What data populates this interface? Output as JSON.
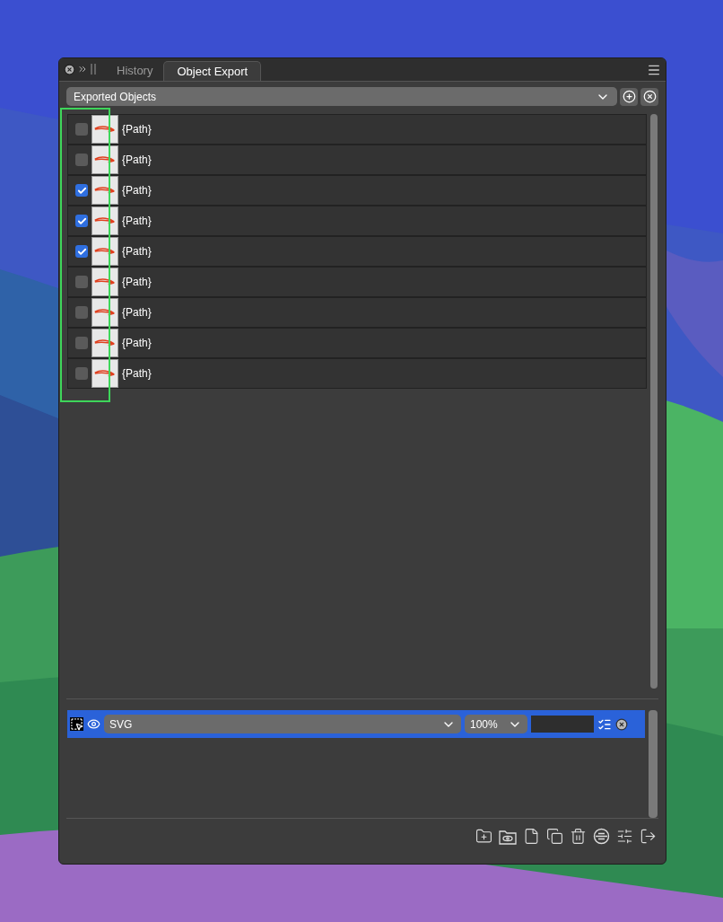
{
  "panel": {
    "tabs": [
      {
        "label": "History",
        "selected": false
      },
      {
        "label": "Object Export",
        "selected": true
      }
    ],
    "group_dropdown": {
      "value": "Exported Objects"
    },
    "objects": [
      {
        "label": "{Path}",
        "checked": false
      },
      {
        "label": "{Path}",
        "checked": false
      },
      {
        "label": "{Path}",
        "checked": true
      },
      {
        "label": "{Path}",
        "checked": true
      },
      {
        "label": "{Path}",
        "checked": true
      },
      {
        "label": "{Path}",
        "checked": false
      },
      {
        "label": "{Path}",
        "checked": false
      },
      {
        "label": "{Path}",
        "checked": false
      },
      {
        "label": "{Path}",
        "checked": false
      }
    ],
    "export_formats": [
      {
        "format": "SVG",
        "scale": "100%",
        "selected": true
      }
    ]
  }
}
